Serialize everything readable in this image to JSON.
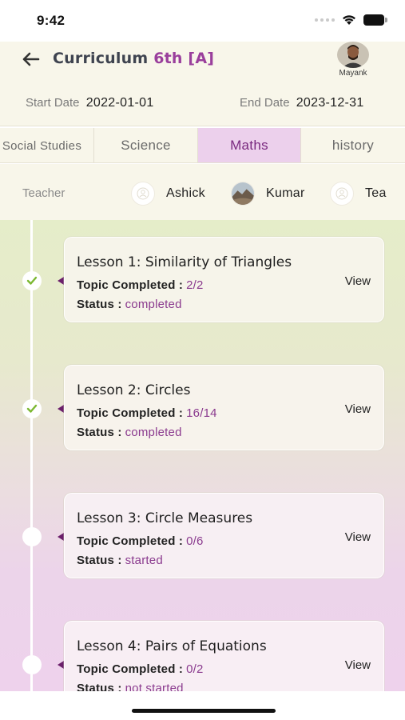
{
  "status_bar": {
    "time": "9:42"
  },
  "header": {
    "title": "Curriculum",
    "class_label": "6th [A]",
    "user": {
      "name": "Mayank"
    }
  },
  "dates": {
    "start_label": "Start Date",
    "start_value": "2022-01-01",
    "end_label": "End Date",
    "end_value": "2023-12-31"
  },
  "tabs": [
    {
      "label": "Social Studies",
      "active": false
    },
    {
      "label": "Science",
      "active": false
    },
    {
      "label": "Maths",
      "active": true
    },
    {
      "label": "history",
      "active": false
    }
  ],
  "teachers": {
    "label": "Teacher",
    "items": [
      {
        "name": "Ashick",
        "icon": "person-placeholder-icon"
      },
      {
        "name": "Kumar",
        "icon": "photo-avatar"
      },
      {
        "name": "Tea",
        "icon": "person-placeholder-icon"
      }
    ]
  },
  "lessons": [
    {
      "title": "Lesson 1: Similarity of Triangles",
      "topic_label": "Topic Completed :",
      "topic_value": "2/2",
      "status_label": "Status :",
      "status_value": "completed",
      "completed": true,
      "view_label": "View"
    },
    {
      "title": "Lesson 2: Circles",
      "topic_label": "Topic Completed :",
      "topic_value": "16/14",
      "status_label": "Status :",
      "status_value": "completed",
      "completed": true,
      "view_label": "View"
    },
    {
      "title": "Lesson 3: Circle Measures",
      "topic_label": "Topic Completed :",
      "topic_value": "0/6",
      "status_label": "Status :",
      "status_value": "started",
      "completed": false,
      "view_label": "View"
    },
    {
      "title": "Lesson 4: Pairs of Equations",
      "topic_label": "Topic Completed :",
      "topic_value": "0/2",
      "status_label": "Status :",
      "status_value": "not started",
      "completed": false,
      "view_label": "View"
    }
  ],
  "colors": {
    "accent": "#9a3f9c",
    "active_tab_bg": "#ecd0ec",
    "check": "#7cb832"
  }
}
